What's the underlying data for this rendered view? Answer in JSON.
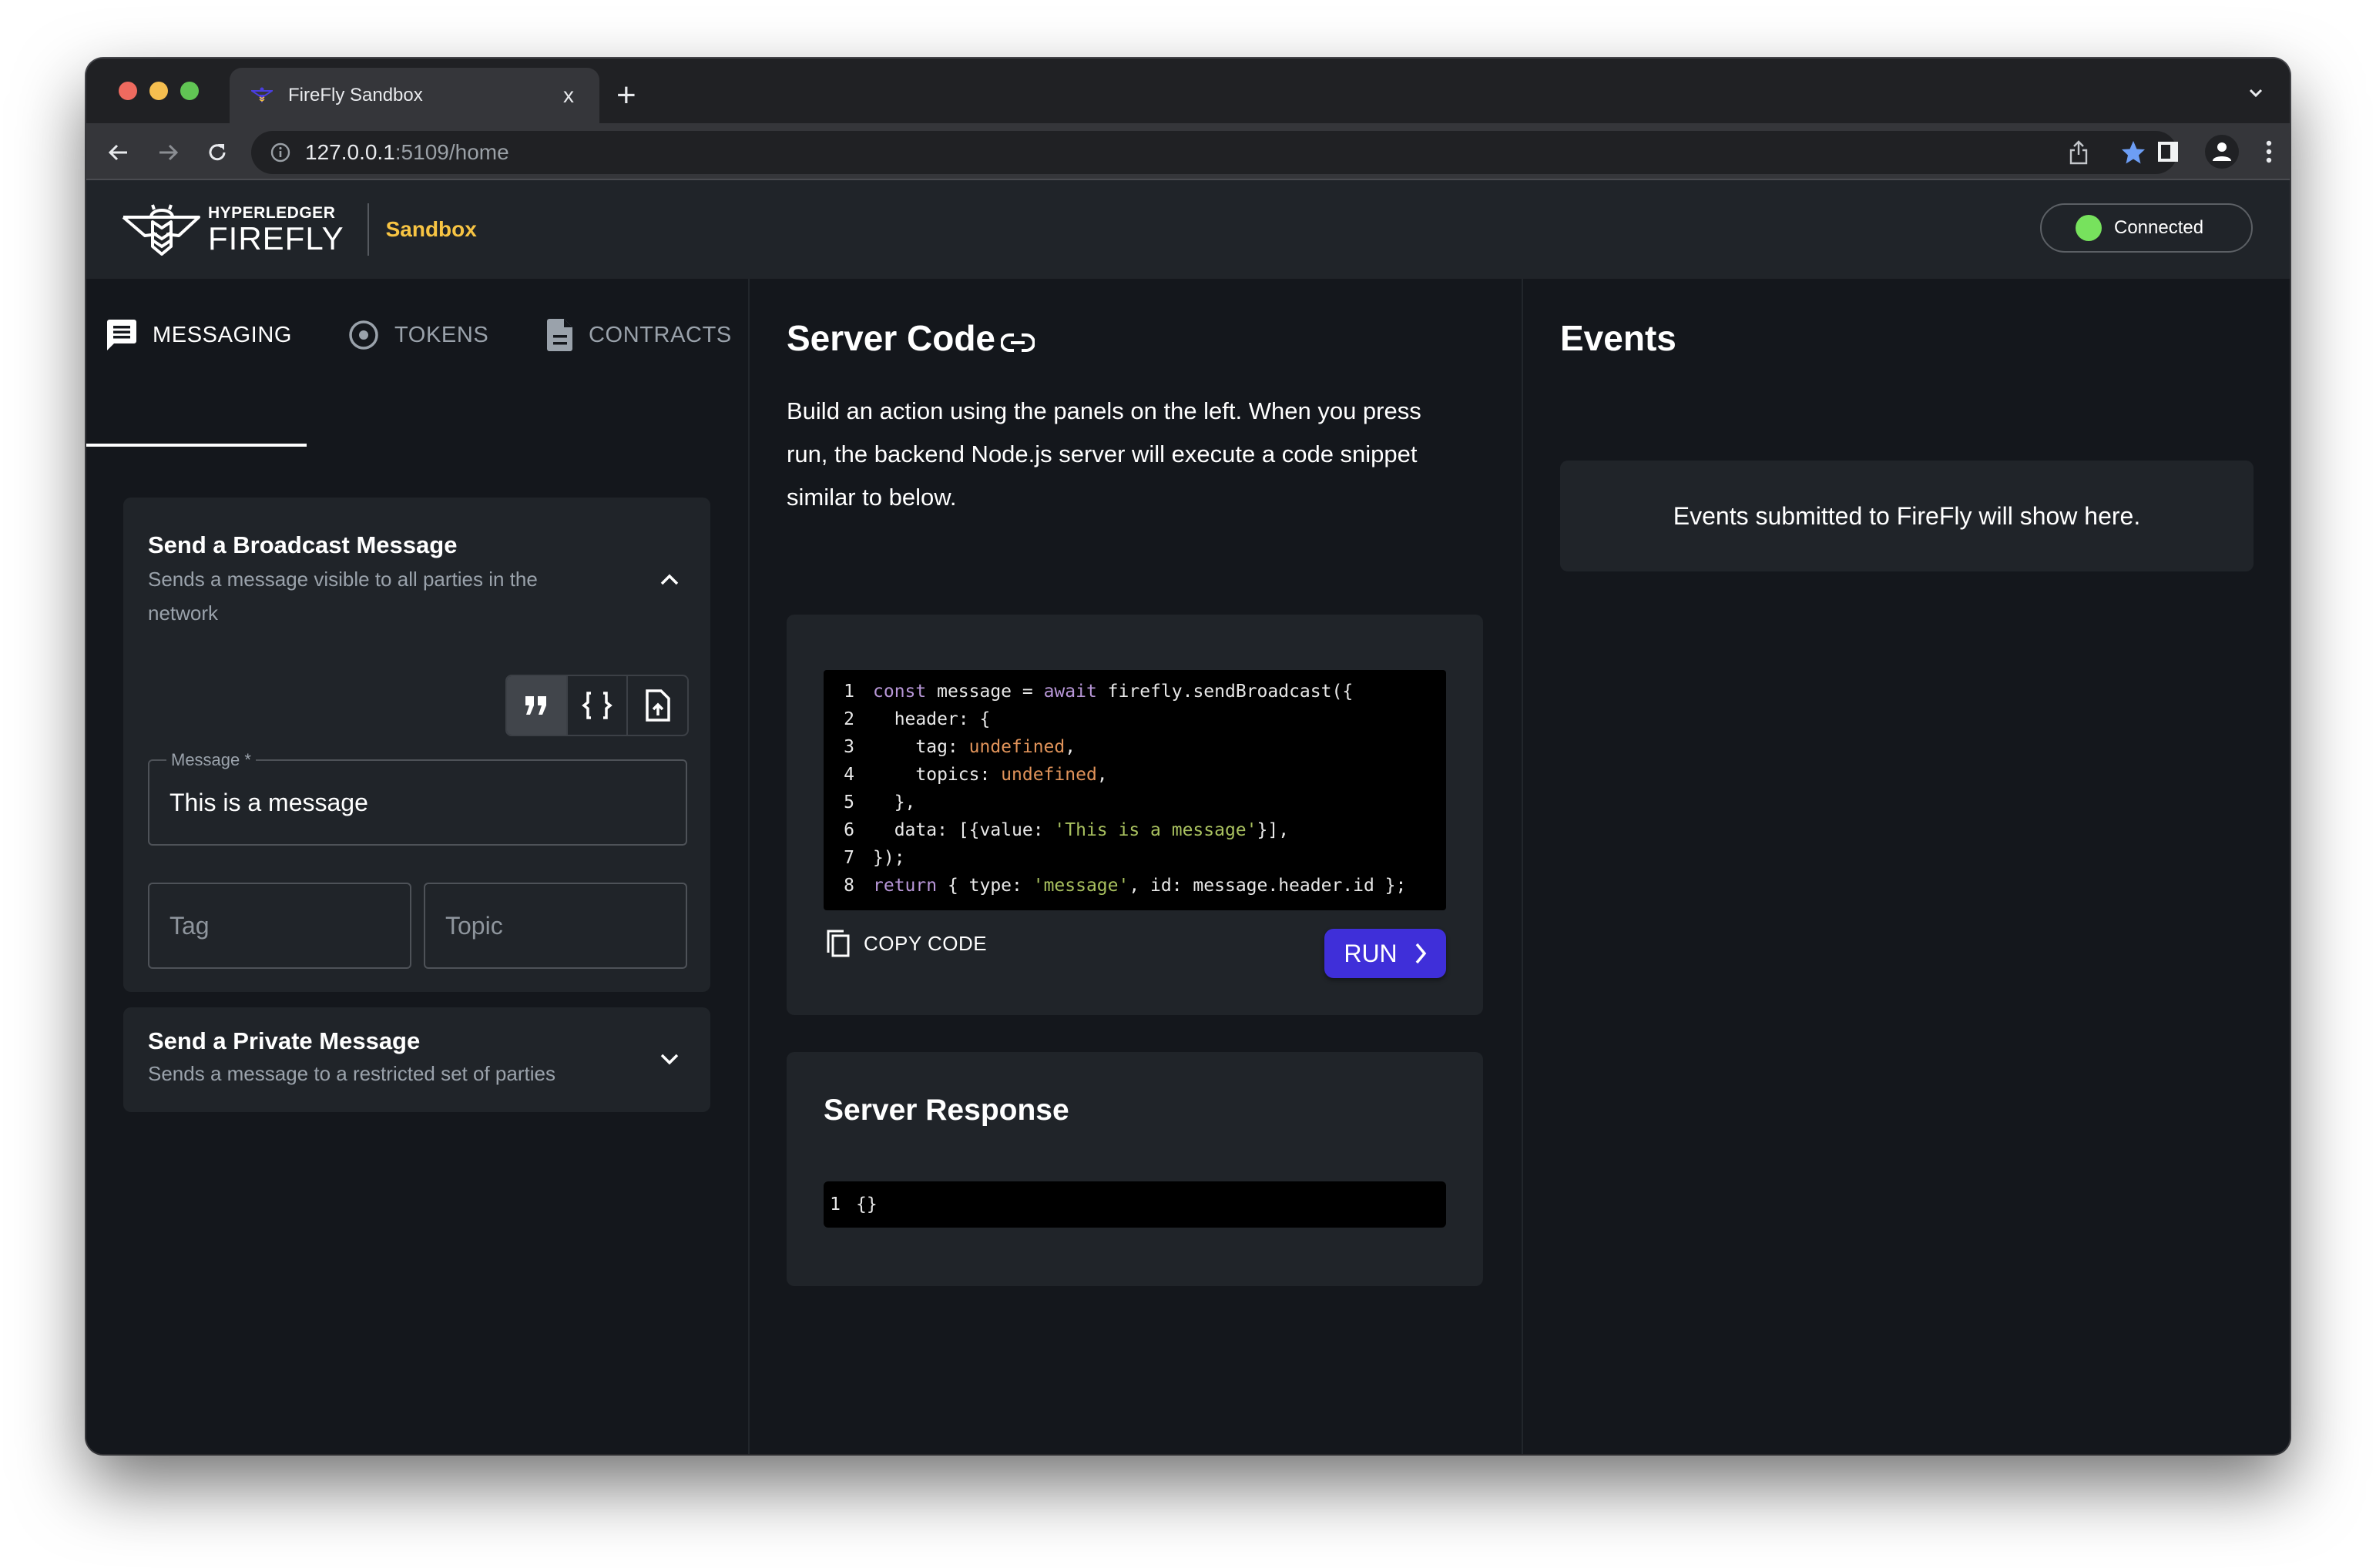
{
  "browser": {
    "tab_title": "FireFly Sandbox",
    "tab_close": "x",
    "new_tab": "+",
    "url_host": "127.0.0.1",
    "url_path": ":5109/home"
  },
  "header": {
    "brand_top": "HYPERLEDGER",
    "brand_bottom": "FIREFLY",
    "app_name": "Sandbox",
    "connection_status": "Connected",
    "colors": {
      "accent": "#f7c443",
      "connected": "#77e25d"
    }
  },
  "left": {
    "tabs": [
      {
        "label": "MESSAGING",
        "icon": "message-icon",
        "active": true
      },
      {
        "label": "TOKENS",
        "icon": "token-icon",
        "active": false
      },
      {
        "label": "CONTRACTS",
        "icon": "document-icon",
        "active": false
      }
    ],
    "broadcast": {
      "title": "Send a Broadcast Message",
      "subtitle_line1": "Sends a message visible to all parties in the",
      "subtitle_line2": "network",
      "format_options": [
        "string",
        "json",
        "file-upload"
      ],
      "selected_format": "string",
      "message_label": "Message *",
      "message_value": "This is a message",
      "tag_placeholder": "Tag",
      "topic_placeholder": "Topic"
    },
    "private": {
      "title": "Send a Private Message",
      "subtitle": "Sends a message to a restricted set of parties"
    }
  },
  "middle": {
    "title": "Server Code",
    "description_lines": [
      "Build an action using the panels on the left. When you press",
      "run, the backend Node.js server will execute a code snippet",
      "similar to below."
    ],
    "code_lines": [
      "const message = await firefly.sendBroadcast({",
      "  header: {",
      "    tag: undefined,",
      "    topics: undefined,",
      "  },",
      "  data: [{value: 'This is a message'}],",
      "});",
      "return { type: 'message', id: message.header.id };"
    ],
    "copy_label": "COPY CODE",
    "run_label": "RUN",
    "response_title": "Server Response",
    "response_lines": [
      "{}"
    ],
    "colors": {
      "run_button": "#3f2fd9"
    }
  },
  "right": {
    "title": "Events",
    "empty_text": "Events submitted to FireFly will show here."
  }
}
